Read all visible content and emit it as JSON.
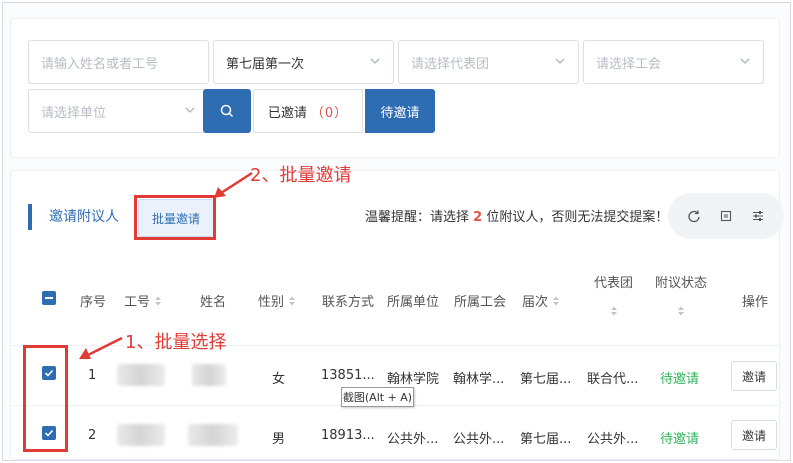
{
  "filters": {
    "name_input_placeholder": "请输入姓名或者工号",
    "session_value": "第七届第一次",
    "delegation_placeholder": "请选择代表团",
    "union_placeholder": "请选择工会",
    "unit_placeholder": "请选择单位",
    "invited_label": "已邀请",
    "invited_count": "（0）",
    "pending_label": "待邀请"
  },
  "toolbar": {
    "title": "邀请附议人",
    "batch_invite_label": "批量邀请",
    "hint_prefix": "温馨提醒：请选择",
    "hint_number": "2",
    "hint_suffix": "位附议人，否则无法提交提案！"
  },
  "annotations": {
    "batch_invite": "2、批量邀请",
    "batch_select": "1、批量选择"
  },
  "table": {
    "headers": {
      "index": "序号",
      "employee_id": "工号",
      "name": "姓名",
      "gender": "性别",
      "contact": "联系方式",
      "unit": "所属单位",
      "union": "所属工会",
      "session": "届次",
      "delegation": "代表团",
      "status": "附议状态",
      "action": "操作"
    },
    "rows": [
      {
        "index": "1",
        "gender": "女",
        "contact": "13851...",
        "unit": "翰林学院",
        "union": "翰林学...",
        "session": "第七届...",
        "delegation": "联合代...",
        "status": "待邀请",
        "action": "邀请"
      },
      {
        "index": "2",
        "gender": "男",
        "contact": "18913...",
        "unit": "公共外...",
        "union": "公共外...",
        "session": "第七届...",
        "delegation": "公共外...",
        "status": "待邀请",
        "action": "邀请"
      }
    ]
  },
  "tooltip": "截图(Alt + A)",
  "colors": {
    "primary": "#2f6db3",
    "annotation_red": "#e23a34",
    "status_green": "#2fb45b",
    "count_red": "#e0534a"
  }
}
